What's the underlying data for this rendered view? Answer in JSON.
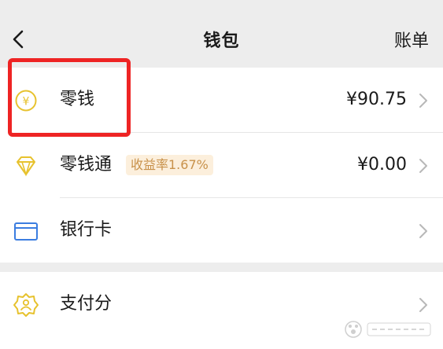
{
  "header": {
    "title": "钱包",
    "right_label": "账单"
  },
  "rows": [
    {
      "label": "零钱",
      "value": "¥90.75",
      "icon": "yen-coin-icon"
    },
    {
      "label": "零钱通",
      "badge": "收益率1.67%",
      "value": "¥0.00",
      "icon": "diamond-icon"
    },
    {
      "label": "银行卡",
      "icon": "bank-card-icon"
    },
    {
      "label": "支付分",
      "icon": "pay-score-badge-icon"
    }
  ],
  "colors": {
    "accent_yellow": "#e7c22e",
    "card_blue": "#3b7de0",
    "highlight_red": "#ee2424",
    "badge_bg": "#fcefdc",
    "badge_text": "#c8914a"
  }
}
